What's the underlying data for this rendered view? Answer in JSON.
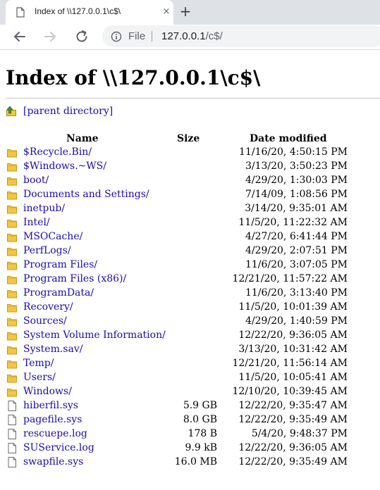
{
  "tab": {
    "title": "Index of \\\\127.0.0.1\\c$\\",
    "close": "×",
    "new_tab": "+"
  },
  "toolbar": {
    "scheme_label": "File",
    "url_host": "127.0.0.1",
    "url_path": "/c$/"
  },
  "page": {
    "heading": "Index of \\\\127.0.0.1\\c$\\",
    "parent_label": "[parent directory]"
  },
  "columns": {
    "name": "Name",
    "size": "Size",
    "modified": "Date modified"
  },
  "entries": [
    {
      "name": "$Recycle.Bin/",
      "size": "",
      "modified": "11/16/20, 4:50:15 PM",
      "type": "folder"
    },
    {
      "name": "$Windows.~WS/",
      "size": "",
      "modified": "3/13/20, 3:50:23 PM",
      "type": "folder"
    },
    {
      "name": "boot/",
      "size": "",
      "modified": "4/29/20, 1:30:03 PM",
      "type": "folder"
    },
    {
      "name": "Documents and Settings/",
      "size": "",
      "modified": "7/14/09, 1:08:56 PM",
      "type": "folder"
    },
    {
      "name": "inetpub/",
      "size": "",
      "modified": "3/14/20, 9:35:01 AM",
      "type": "folder"
    },
    {
      "name": "Intel/",
      "size": "",
      "modified": "11/5/20, 11:22:32 AM",
      "type": "folder"
    },
    {
      "name": "MSOCache/",
      "size": "",
      "modified": "4/27/20, 6:41:44 PM",
      "type": "folder"
    },
    {
      "name": "PerfLogs/",
      "size": "",
      "modified": "4/29/20, 2:07:51 PM",
      "type": "folder"
    },
    {
      "name": "Program Files/",
      "size": "",
      "modified": "11/6/20, 3:07:05 PM",
      "type": "folder"
    },
    {
      "name": "Program Files (x86)/",
      "size": "",
      "modified": "12/21/20, 11:57:22 AM",
      "type": "folder"
    },
    {
      "name": "ProgramData/",
      "size": "",
      "modified": "11/6/20, 3:13:40 PM",
      "type": "folder"
    },
    {
      "name": "Recovery/",
      "size": "",
      "modified": "11/5/20, 10:01:39 AM",
      "type": "folder"
    },
    {
      "name": "Sources/",
      "size": "",
      "modified": "4/29/20, 1:40:59 PM",
      "type": "folder"
    },
    {
      "name": "System Volume Information/",
      "size": "",
      "modified": "12/22/20, 9:36:05 AM",
      "type": "folder"
    },
    {
      "name": "System.sav/",
      "size": "",
      "modified": "3/13/20, 10:31:42 AM",
      "type": "folder"
    },
    {
      "name": "Temp/",
      "size": "",
      "modified": "12/21/20, 11:56:14 AM",
      "type": "folder"
    },
    {
      "name": "Users/",
      "size": "",
      "modified": "11/5/20, 10:05:41 AM",
      "type": "folder"
    },
    {
      "name": "Windows/",
      "size": "",
      "modified": "12/10/20, 10:39:45 AM",
      "type": "folder"
    },
    {
      "name": "hiberfil.sys",
      "size": "5.9 GB",
      "modified": "12/22/20, 9:35:47 AM",
      "type": "file"
    },
    {
      "name": "pagefile.sys",
      "size": "8.0 GB",
      "modified": "12/22/20, 9:35:49 AM",
      "type": "file"
    },
    {
      "name": "rescuepe.log",
      "size": "178 B",
      "modified": "5/4/20, 9:48:37 PM",
      "type": "file"
    },
    {
      "name": "SUService.log",
      "size": "9.9 kB",
      "modified": "12/22/20, 9:36:05 AM",
      "type": "file"
    },
    {
      "name": "swapfile.sys",
      "size": "16.0 MB",
      "modified": "12/22/20, 9:35:49 AM",
      "type": "file"
    }
  ],
  "icons": {
    "folder": "folder-icon",
    "file": "file-icon",
    "parent": "up-arrow-icon",
    "back": "back-arrow-icon",
    "forward": "forward-arrow-icon",
    "reload": "reload-icon",
    "info": "info-icon"
  },
  "colors": {
    "link": "#1a0dab",
    "tabstrip": "#dee1e6",
    "omnibox": "#f1f3f4",
    "folder": "#f4c542",
    "parent_arrow": "#3a9a2c"
  }
}
